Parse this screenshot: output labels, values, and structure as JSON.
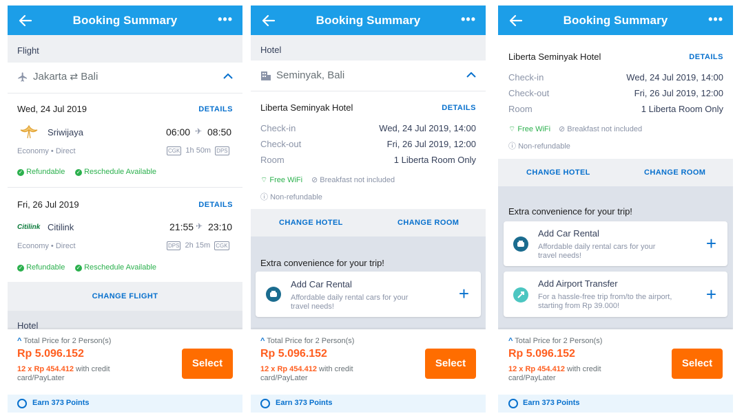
{
  "colors": {
    "header": "#1c9ee8",
    "accent_blue": "#0770cd",
    "orange": "#ff5e1f",
    "select_button": "#ff6d00",
    "green": "#2bb04d"
  },
  "header": {
    "title": "Booking Summary",
    "back_icon": "arrow-left-icon",
    "more_icon": "more-dots-icon"
  },
  "common": {
    "details_label": "DETAILS",
    "total_label": "Total Price for 2 Person(s)",
    "total_price": "Rp 5.096.152",
    "installment_amount": "12 x Rp 454.412",
    "installment_line1": "with credit",
    "installment_line2": "card/PayLater",
    "select_label": "Select",
    "points_label": "Earn 373 Points",
    "refundable": "Refundable",
    "reschedule": "Reschedule Available",
    "free_wifi": "Free WiFi",
    "breakfast": "Breakfast not included",
    "non_refundable": "Non-refundable",
    "change_hotel": "CHANGE HOTEL",
    "change_room": "CHANGE ROOM",
    "extra_title": "Extra convenience for your trip!",
    "car_rental_title": "Add Car Rental",
    "car_rental_desc1": "Affordable daily rental cars for your",
    "car_rental_desc2": "travel needs!",
    "airport_title": "Add Airport Transfer",
    "airport_desc1": "For a hassle-free trip from/to the airport,",
    "airport_desc2": "starting from Rp 39.000!"
  },
  "flight": {
    "section_label": "Flight",
    "origin": "Jakarta",
    "destination": "Bali",
    "change_flight": "CHANGE FLIGHT",
    "next_section_label": "Hotel",
    "segments": [
      {
        "date": "Wed, 24 Jul 2019",
        "airline": "Sriwijaya",
        "depart": "06:00",
        "arrive": "08:50",
        "class": "Economy • Direct",
        "from_code": "CGK",
        "duration": "1h 50m",
        "to_code": "DPS"
      },
      {
        "date": "Fri, 26 Jul 2019",
        "airline": "Citilink",
        "airline_logo_text": "Citilink",
        "depart": "21:55",
        "arrive": "23:10",
        "class": "Economy • Direct",
        "from_code": "DPS",
        "duration": "2h 15m",
        "to_code": "CGK"
      }
    ]
  },
  "hotel": {
    "section_label": "Hotel",
    "location": "Seminyak, Bali",
    "name": "Liberta Seminyak Hotel",
    "checkin_label": "Check-in",
    "checkin_value": "Wed, 24 Jul 2019, 14:00",
    "checkout_label": "Check-out",
    "checkout_value": "Fri, 26 Jul 2019, 12:00",
    "room_label": "Room",
    "room_value": "1 Liberta Room Only"
  }
}
